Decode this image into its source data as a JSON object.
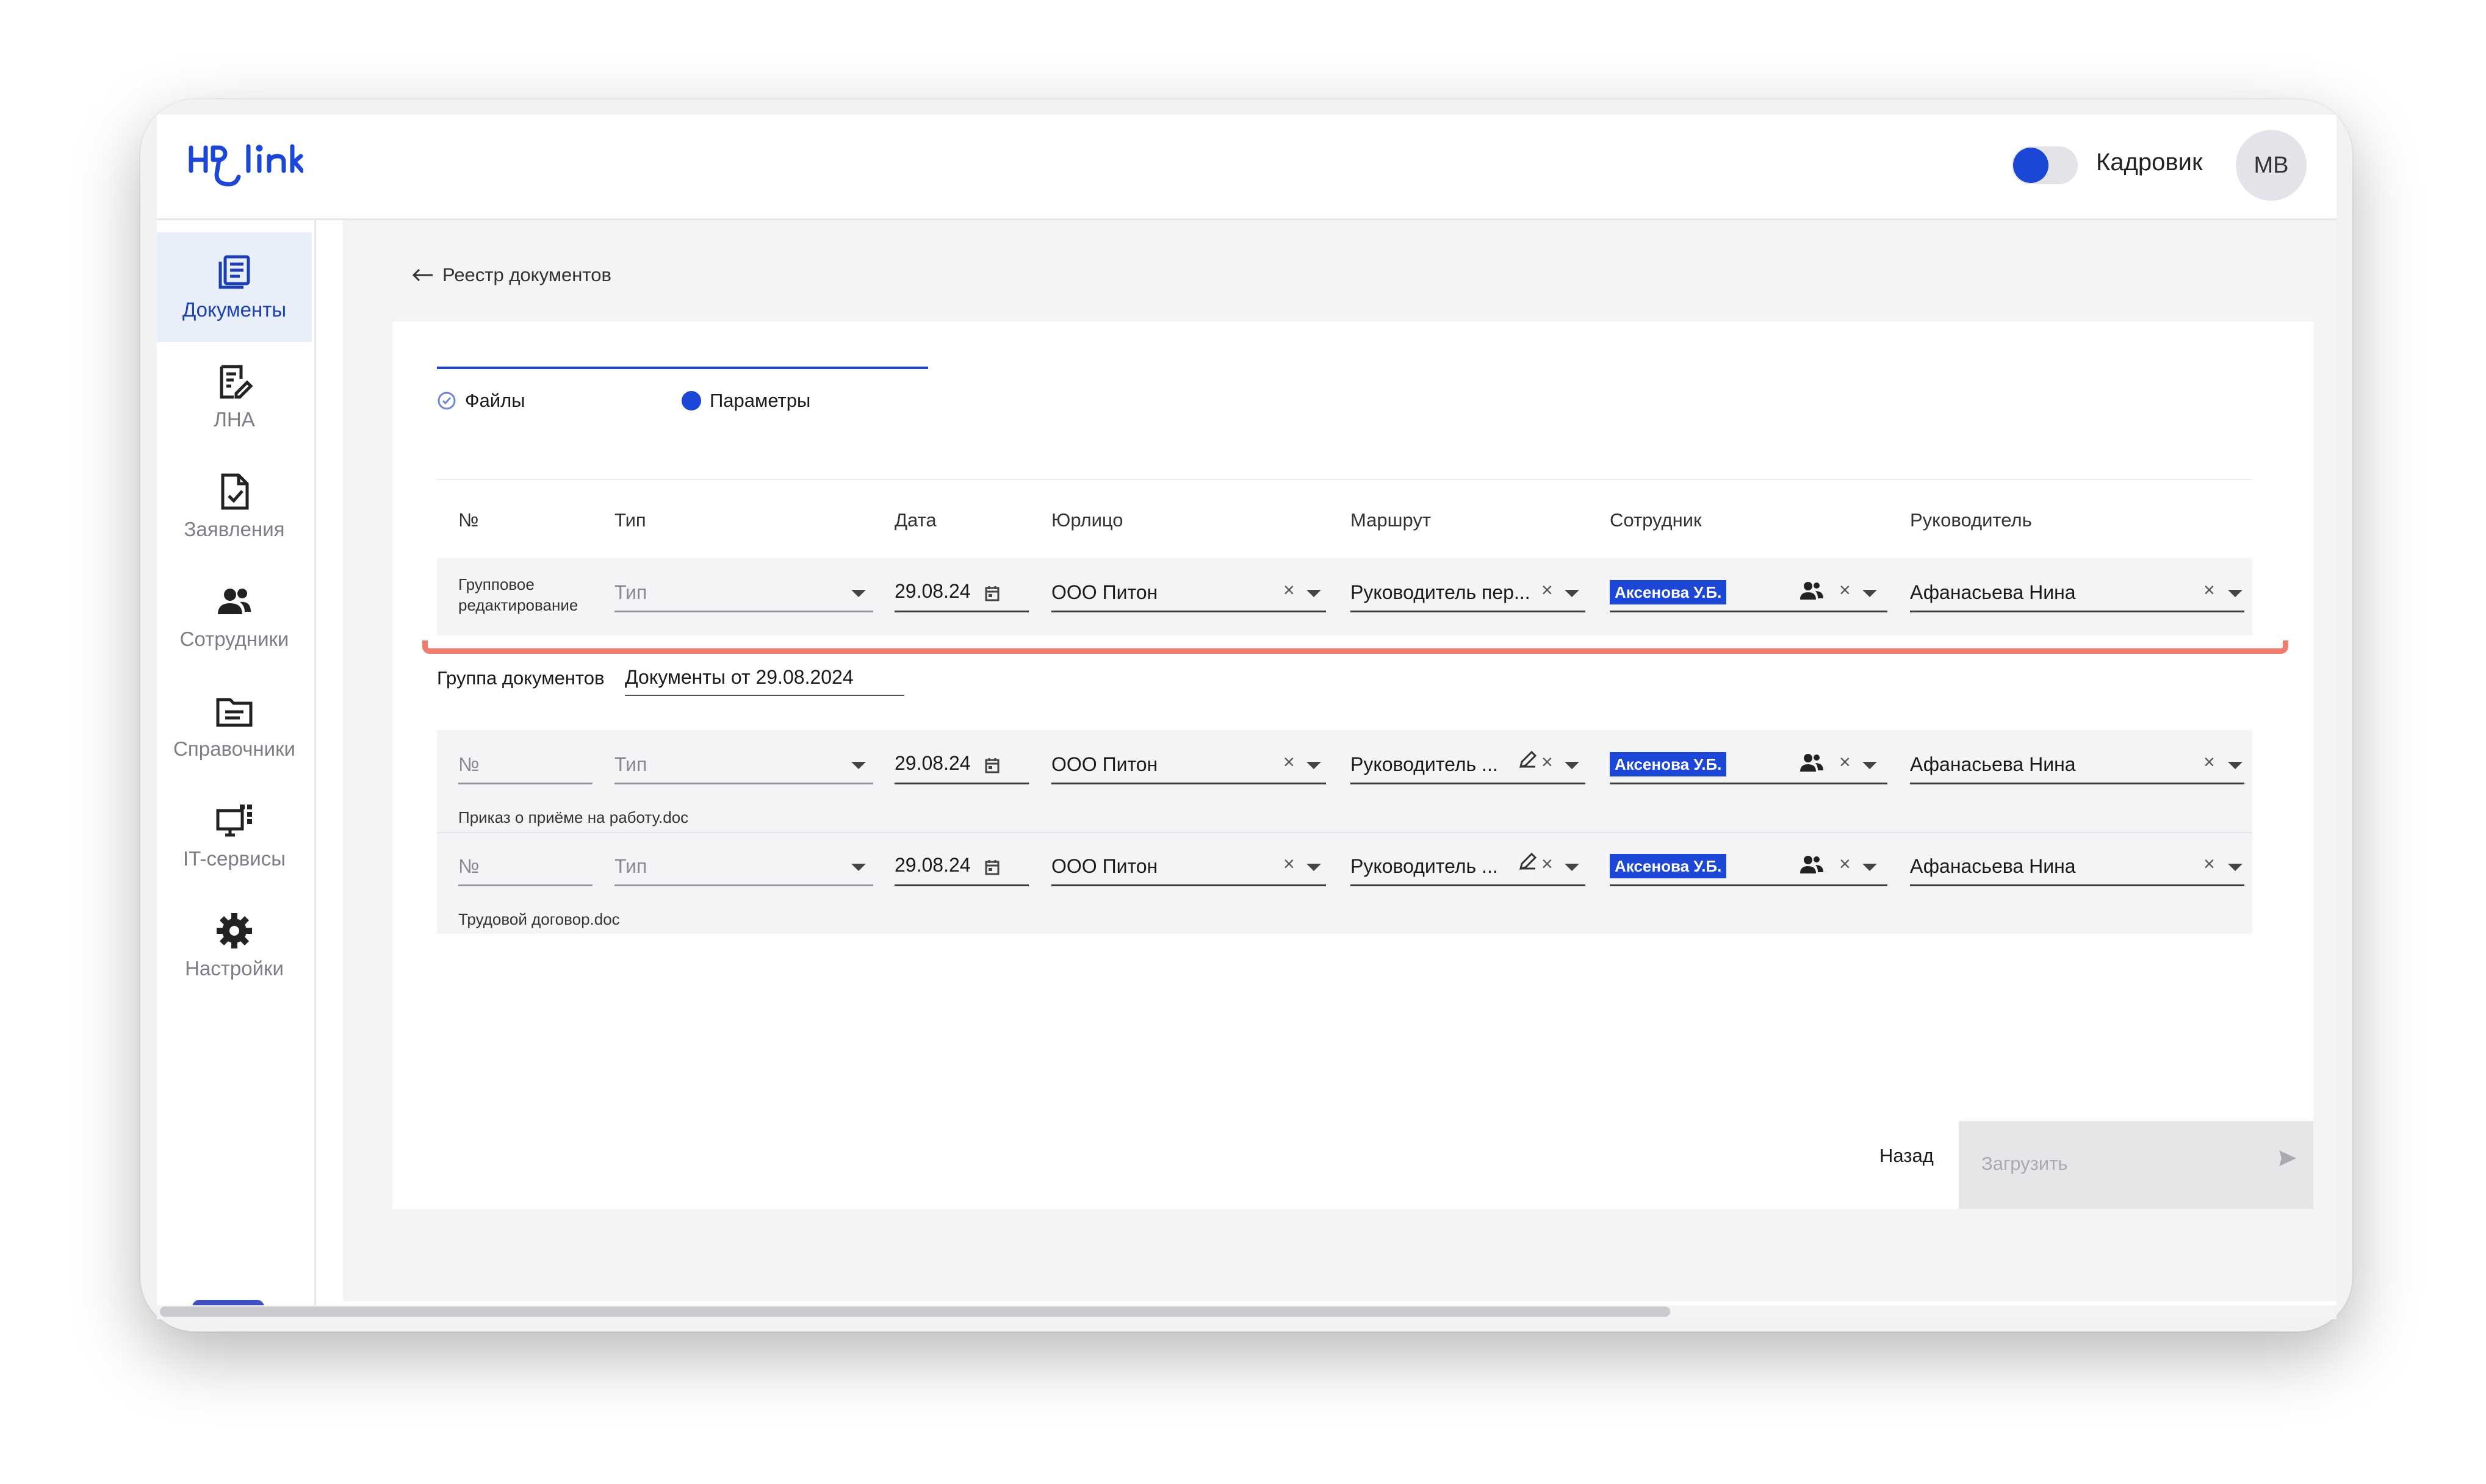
{
  "app": {
    "logo": "HRlink"
  },
  "header": {
    "role_label": "Кадровик",
    "avatar_initials": "МВ"
  },
  "sidebar": {
    "items": [
      {
        "label": "Документы",
        "icon": "documents-icon"
      },
      {
        "label": "ЛНА",
        "icon": "lna-icon"
      },
      {
        "label": "Заявления",
        "icon": "applications-icon"
      },
      {
        "label": "Сотрудники",
        "icon": "employees-icon"
      },
      {
        "label": "Справочники",
        "icon": "directories-icon"
      },
      {
        "label": "IT-сервисы",
        "icon": "it-services-icon"
      },
      {
        "label": "Настройки",
        "icon": "settings-icon"
      }
    ],
    "help_label": "?"
  },
  "breadcrumb": {
    "back_label": "Реестр документов"
  },
  "stepper": {
    "steps": [
      "Файлы",
      "Параметры"
    ]
  },
  "table": {
    "columns": [
      "№",
      "Тип",
      "Дата",
      "Юрлицо",
      "Маршрут",
      "Сотрудник",
      "Руководитель"
    ],
    "group_edit": {
      "label_line1": "Групповое",
      "label_line2": "редактирование",
      "type_placeholder": "Тип",
      "date": "29.08.24",
      "legal_entity": "ООО Питон",
      "route": "Руководитель пер...",
      "employee": "Аксенова У.Б.",
      "manager": "Афанасьева Нина"
    },
    "group_name_label": "Группа документов",
    "group_name_value": "Документы от 29.08.2024",
    "rows": [
      {
        "number_placeholder": "№",
        "type_placeholder": "Тип",
        "date": "29.08.24",
        "legal_entity": "ООО Питон",
        "route": "Руководитель ...",
        "employee": "Аксенова У.Б.",
        "manager": "Афанасьева Нина",
        "file_name": "Приказ о приёме на работу.doc"
      },
      {
        "number_placeholder": "№",
        "type_placeholder": "Тип",
        "date": "29.08.24",
        "legal_entity": "ООО Питон",
        "route": "Руководитель ...",
        "employee": "Аксенова У.Б.",
        "manager": "Афанасьева Нина",
        "file_name": "Трудовой договор.doc"
      }
    ]
  },
  "actions": {
    "back_label": "Назад",
    "upload_label": "Загрузить"
  },
  "colors": {
    "accent": "#1c47d6",
    "highlight": "#f07c6e",
    "tag": "#1c47d6"
  }
}
